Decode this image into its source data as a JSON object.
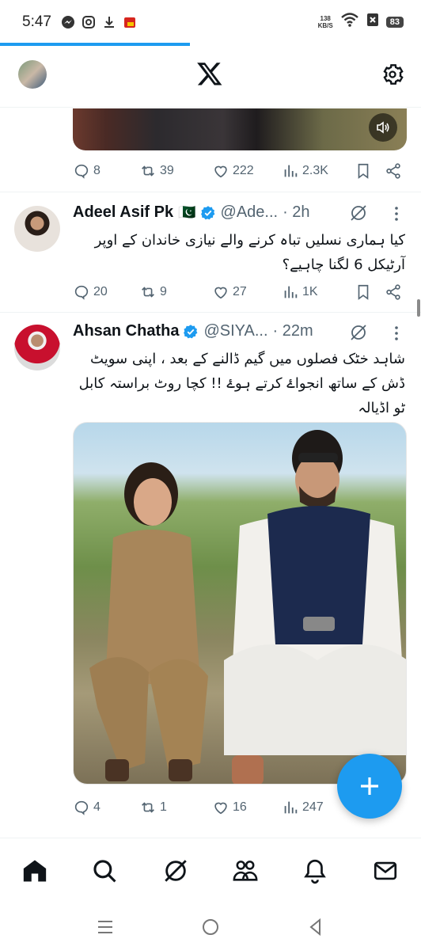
{
  "status_bar": {
    "time": "5:47",
    "net_speed_value": "138",
    "net_speed_unit": "KB/S",
    "battery": "83"
  },
  "header": {
    "logo": "x-logo",
    "settings_icon": "gear-icon"
  },
  "tweets": [
    {
      "stats": {
        "replies": "8",
        "reposts": "39",
        "likes": "222",
        "views": "2.3K"
      }
    },
    {
      "name": "Adeel Asif Pk",
      "flag": "🇵🇰",
      "handle": "@Ade...",
      "time": "· 2h",
      "text": "کیا ہماری نسلیں تباہ کرنے والے نیازی خاندان کے اوپر آرٹیکل 6 لگنا چاہیے؟",
      "stats": {
        "replies": "20",
        "reposts": "9",
        "likes": "27",
        "views": "1K"
      }
    },
    {
      "name": "Ahsan Chatha",
      "handle": "@SIYA...",
      "time": "· 22m",
      "text": "شاہد خٹک فصلوں میں گیم ڈالنے کے بعد ، اپنی سویٹ ڈش کے ساتھ انجواۓ کرتے ہوۓ !! کچا روٹ براستہ کابل ٹو اڈیالہ",
      "stats": {
        "replies": "4",
        "reposts": "1",
        "likes": "16",
        "views": "247"
      }
    }
  ],
  "colors": {
    "accent": "#1d9bf0",
    "verified": "#1d9bf0",
    "text_secondary": "#536471"
  }
}
